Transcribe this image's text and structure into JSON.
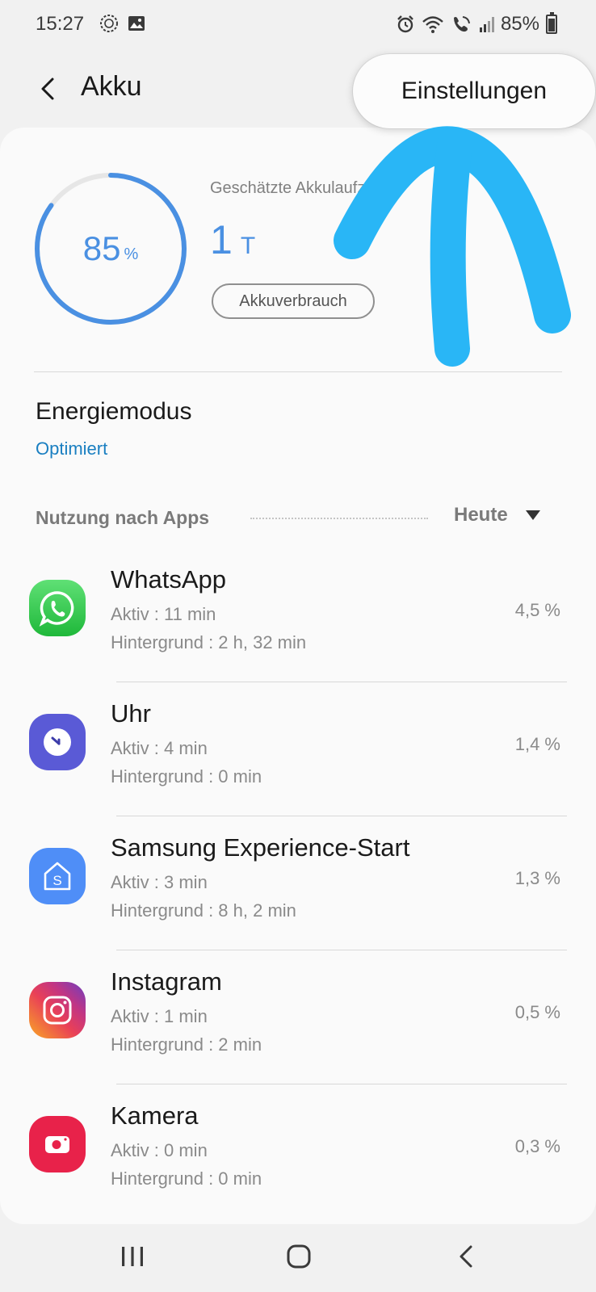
{
  "status_bar": {
    "time": "15:27",
    "battery_percent": "85%",
    "icons": [
      "sync-icon",
      "image-icon",
      "alarm-icon",
      "wifi-icon",
      "wifi-calling-icon",
      "signal-icon",
      "battery-icon"
    ]
  },
  "header": {
    "title": "Akku",
    "back_icon": "back-arrow-icon"
  },
  "popup_menu": {
    "item": "Einstellungen"
  },
  "battery": {
    "level_value": 85,
    "level_number": "85",
    "level_unit": "%",
    "estimate_label": "Geschätzte Akkulaufzeit",
    "estimate_number": "1",
    "estimate_unit": "T",
    "usage_button": "Akkuverbrauch",
    "accent_color": "#4a90e2"
  },
  "power_mode": {
    "title": "Energiemodus",
    "value": "Optimiert"
  },
  "usage": {
    "section_label": "Nutzung nach Apps",
    "period": "Heute"
  },
  "apps": [
    {
      "name": "WhatsApp",
      "active": "Aktiv : 11 min",
      "background": "Hintergrund : 2 h, 32 min",
      "percent": "4,5 %",
      "icon": "whatsapp-icon",
      "color": "#2ecc4f"
    },
    {
      "name": "Uhr",
      "active": "Aktiv : 4 min",
      "background": "Hintergrund : 0 min",
      "percent": "1,4 %",
      "icon": "clock-icon",
      "color": "#5a5ad6"
    },
    {
      "name": "Samsung Experience-Start",
      "active": "Aktiv : 3 min",
      "background": "Hintergrund : 8 h, 2 min",
      "percent": "1,3 %",
      "icon": "samsung-home-icon",
      "color": "#4f8ef7"
    },
    {
      "name": "Instagram",
      "active": "Aktiv : 1 min",
      "background": "Hintergrund : 2 min",
      "percent": "0,5 %",
      "icon": "instagram-icon",
      "color": "#d62976"
    },
    {
      "name": "Kamera",
      "active": "Aktiv : 0 min",
      "background": "Hintergrund : 0 min",
      "percent": "0,3 %",
      "icon": "camera-icon",
      "color": "#e8224a"
    }
  ],
  "nav_bar": {
    "icons": [
      "recent-apps-icon",
      "home-icon",
      "back-icon"
    ]
  },
  "annotation_color": "#29b6f6"
}
